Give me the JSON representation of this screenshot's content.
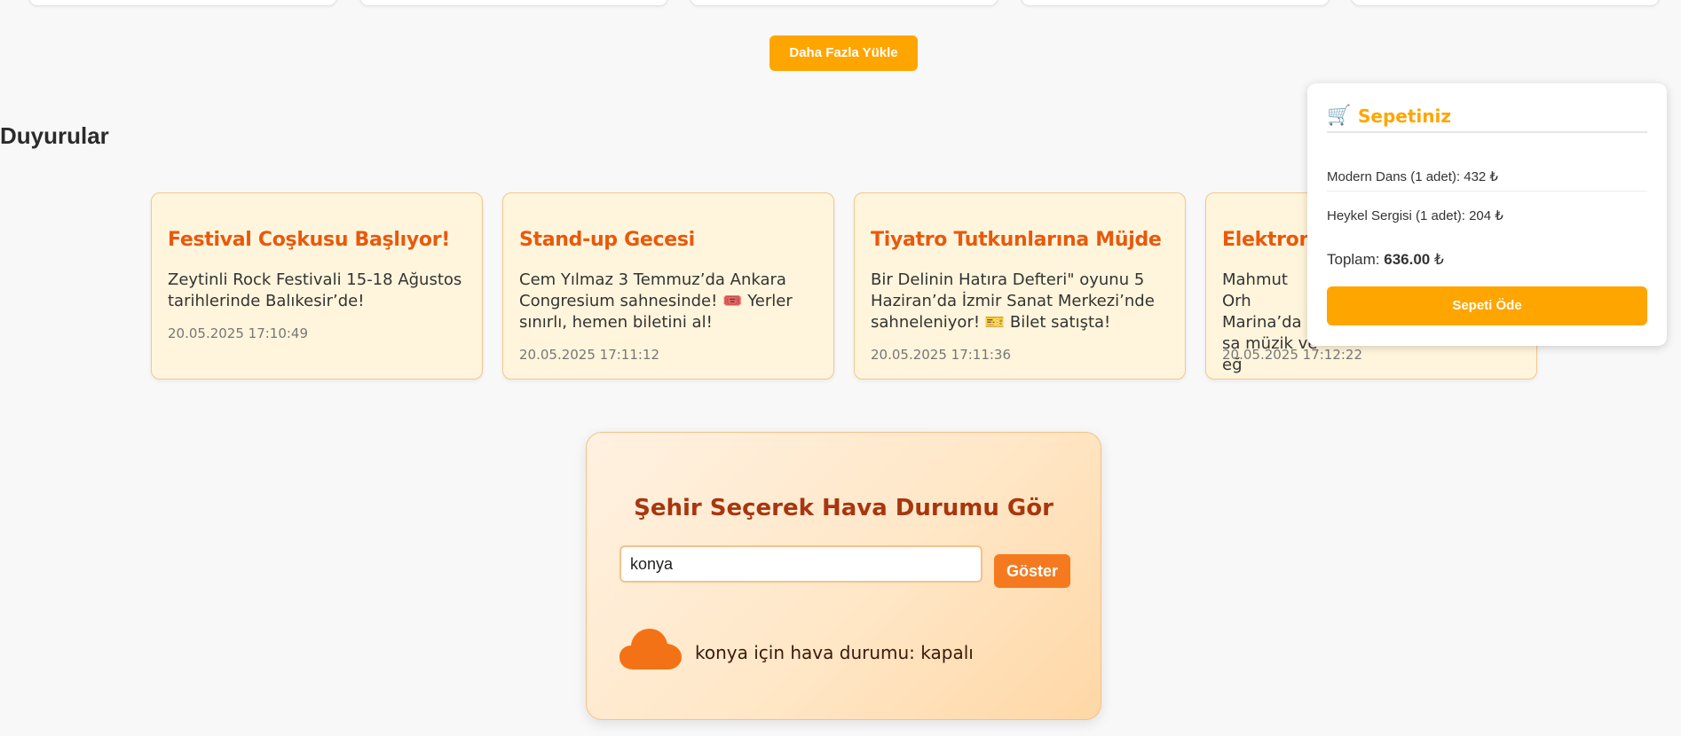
{
  "load_more": {
    "label": "Daha Fazla Yükle"
  },
  "announcements": {
    "title": "Duyurular",
    "items": [
      {
        "title": "Festival Coşkusu Başlıyor!",
        "text": "Zeytinli Rock Festivali 15-18 Ağustos tarihlerinde Balıkesir’de!",
        "date": "20.05.2025 17:10:49"
      },
      {
        "title": "Stand-up Gecesi",
        "text": "Cem Yılmaz 3 Temmuz’da Ankara Congresium sahnesinde! 🎟️ Yerler sınırlı, hemen biletini al!",
        "date": "20.05.2025 17:11:12"
      },
      {
        "title": "Tiyatro Tutkunlarına Müjde",
        "text": "Bir Delinin Hatıra Defteri\" oyunu 5 Haziran’da İzmir Sanat Merkezi’nde sahneleniyor! 🎫 Bilet satışta!",
        "date": "20.05.2025 17:11:36"
      },
      {
        "title": "Elektronik",
        "text": "Mahmut Orh Marina’da sa müzik ve eğ",
        "date": "20.05.2025 17:12:22"
      }
    ]
  },
  "weather": {
    "title": "Şehir Seçerek Hava Durumu Gör",
    "input_value": "konya",
    "button_label": "Göster",
    "result": "konya için hava durumu: kapalı",
    "icon": "cloud-icon"
  },
  "cart": {
    "icon": "cart-icon",
    "title": "Sepetiniz",
    "items": [
      {
        "label": "Modern Dans (1 adet): 432 ₺"
      },
      {
        "label": "Heykel Sergisi (1 adet): 204 ₺"
      }
    ],
    "total_label": "Toplam:",
    "total_value": "636.00",
    "currency": "₺",
    "pay_label": "Sepeti Öde"
  },
  "colors": {
    "accent": "#ffa500",
    "announcement_title": "#e8590c",
    "weather_button": "#f57a1f"
  }
}
